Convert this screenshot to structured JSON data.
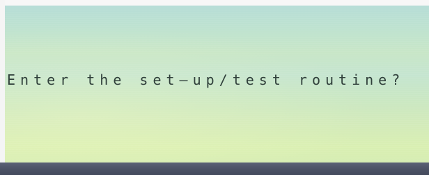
{
  "screen": {
    "prompt_text": "Enter the set—up∕test routine?"
  },
  "colors": {
    "screen_top": "#b6ddd7",
    "screen_bottom": "#d9efb2",
    "text": "#2f3f3a",
    "bezel": "#4c5266"
  }
}
